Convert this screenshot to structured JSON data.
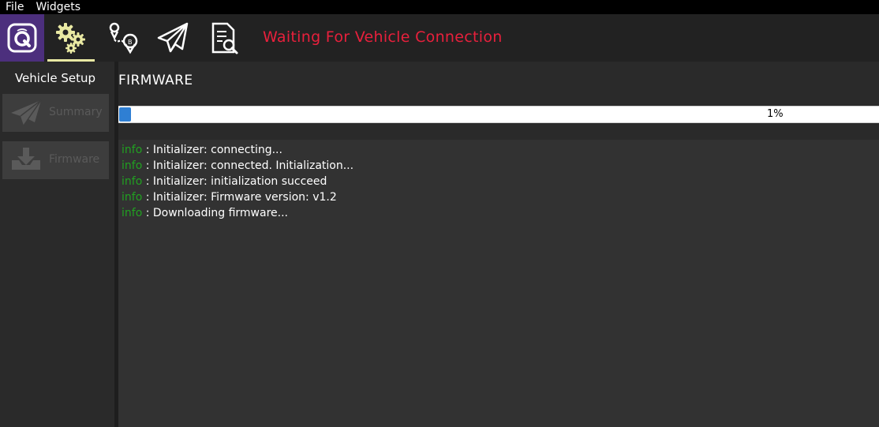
{
  "menu": [
    "File",
    "Widgets"
  ],
  "toolbar": {
    "icons": [
      "qgc-logo-icon",
      "vehicle-setup-gears-icon",
      "plan-view-icon",
      "fly-view-icon",
      "analyze-icon"
    ],
    "status": "Waiting For Vehicle Connection",
    "status_color": "#e8203c",
    "active_color": "#e9e9a3"
  },
  "sidebar": {
    "title": "Vehicle Setup",
    "items": [
      {
        "label": "Summary",
        "icon": "paper-plane-icon"
      },
      {
        "label": "Firmware",
        "icon": "download-icon"
      }
    ]
  },
  "main": {
    "title": "FIRMWARE",
    "progress_percent": 1,
    "progress_label": "1%",
    "log": [
      {
        "level": "info",
        "message": " : Initializer: connecting..."
      },
      {
        "level": "info",
        "message": " : Initializer: connected. Initialization..."
      },
      {
        "level": "info",
        "message": " : Initializer: initialization succeed"
      },
      {
        "level": "info",
        "message": " : Initializer: Firmware version: v1.2"
      },
      {
        "level": "info",
        "message": " : Downloading firmware..."
      }
    ]
  }
}
